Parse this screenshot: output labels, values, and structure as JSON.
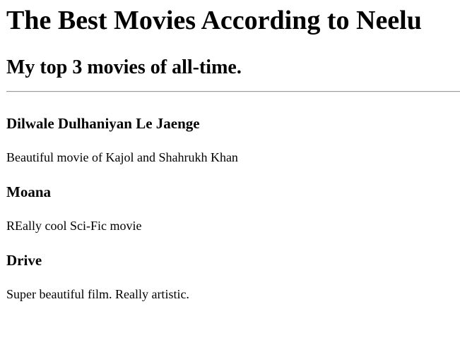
{
  "page": {
    "title": "The Best Movies According to Neelu",
    "subtitle": "My top 3 movies of all-time."
  },
  "movies": [
    {
      "title": "Dilwale Dulhaniyan Le Jaenge",
      "description": "Beautiful movie of Kajol and Shahrukh Khan"
    },
    {
      "title": "Moana",
      "description": "REally cool Sci-Fic movie"
    },
    {
      "title": "Drive",
      "description": "Super beautiful film. Really artistic."
    }
  ]
}
